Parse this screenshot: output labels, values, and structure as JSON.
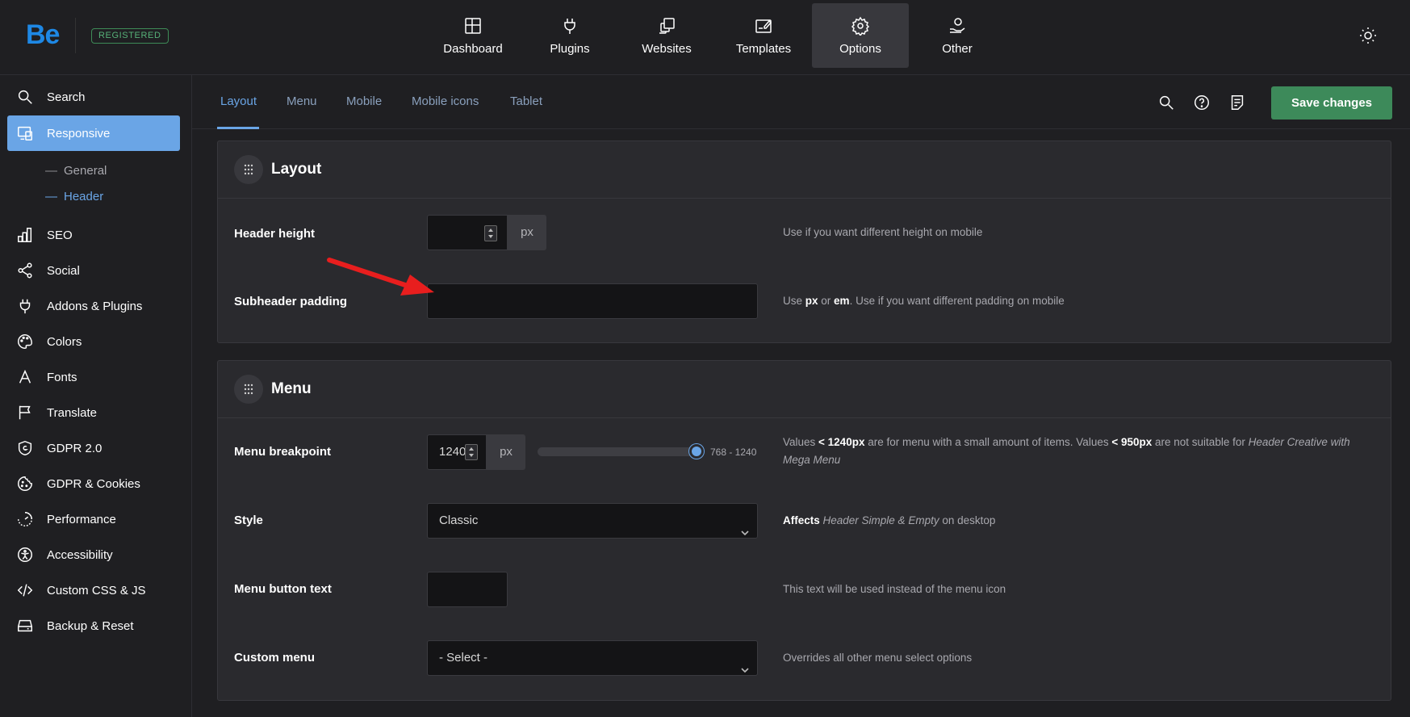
{
  "header": {
    "logo": "Be",
    "badge": "REGISTERED",
    "nav": [
      {
        "label": "Dashboard",
        "icon": "dashboard-icon"
      },
      {
        "label": "Plugins",
        "icon": "plug-icon"
      },
      {
        "label": "Websites",
        "icon": "websites-icon"
      },
      {
        "label": "Templates",
        "icon": "templates-icon"
      },
      {
        "label": "Options",
        "icon": "gear-icon",
        "active": true
      },
      {
        "label": "Other",
        "icon": "other-icon"
      }
    ],
    "theme_toggle_icon": "sun-icon"
  },
  "sidebar": {
    "items": [
      {
        "label": "Search",
        "icon": "search-icon"
      },
      {
        "label": "Responsive",
        "icon": "responsive-icon",
        "active": true
      },
      {
        "label": "SEO",
        "icon": "seo-icon"
      },
      {
        "label": "Social",
        "icon": "share-icon"
      },
      {
        "label": "Addons & Plugins",
        "icon": "plug-icon"
      },
      {
        "label": "Colors",
        "icon": "palette-icon"
      },
      {
        "label": "Fonts",
        "icon": "font-icon"
      },
      {
        "label": "Translate",
        "icon": "flag-icon"
      },
      {
        "label": "GDPR 2.0",
        "icon": "shield-icon"
      },
      {
        "label": "GDPR & Cookies",
        "icon": "cookie-icon"
      },
      {
        "label": "Performance",
        "icon": "performance-icon"
      },
      {
        "label": "Accessibility",
        "icon": "accessibility-icon"
      },
      {
        "label": "Custom CSS & JS",
        "icon": "code-icon"
      },
      {
        "label": "Backup & Reset",
        "icon": "backup-icon"
      }
    ],
    "subitems": [
      {
        "label": "General",
        "active": false
      },
      {
        "label": "Header",
        "active": true
      }
    ]
  },
  "subtabs": {
    "tabs": [
      "Layout",
      "Menu",
      "Mobile",
      "Mobile icons",
      "Tablet"
    ],
    "active": "Layout",
    "save_label": "Save changes"
  },
  "panels": {
    "layout": {
      "title": "Layout",
      "rows": {
        "header_height": {
          "label": "Header height",
          "value": "",
          "unit": "px",
          "desc": "Use if you want different height on mobile"
        },
        "subheader_padding": {
          "label": "Subheader padding",
          "value": "",
          "desc_pre": "Use ",
          "desc_b1": "px",
          "desc_mid": " or ",
          "desc_b2": "em",
          "desc_post": ". Use if you want different padding on mobile"
        }
      }
    },
    "menu": {
      "title": "Menu",
      "rows": {
        "breakpoint": {
          "label": "Menu breakpoint",
          "value": "1240",
          "unit": "px",
          "range": "768 - 1240",
          "desc_1": "Values ",
          "desc_b1": "< 1240px",
          "desc_2": " are for menu with a small amount of items. Values ",
          "desc_b2": "< 950px",
          "desc_3": " are not suitable for ",
          "desc_i1": "Header Creative with Mega Menu"
        },
        "style": {
          "label": "Style",
          "value": "Classic",
          "desc_b": "Affects",
          "desc_i": " Header Simple & Empty",
          "desc_post": " on desktop"
        },
        "button_text": {
          "label": "Menu button text",
          "value": "",
          "desc": "This text will be used instead of the menu icon"
        },
        "custom_menu": {
          "label": "Custom menu",
          "value": "- Select -",
          "desc": "Overrides all other menu select options"
        }
      }
    }
  },
  "colors": {
    "accent": "#6aa5e6",
    "save": "#3d8a5a",
    "logo": "#1e88e5",
    "annotation_arrow": "#e81e1e"
  }
}
